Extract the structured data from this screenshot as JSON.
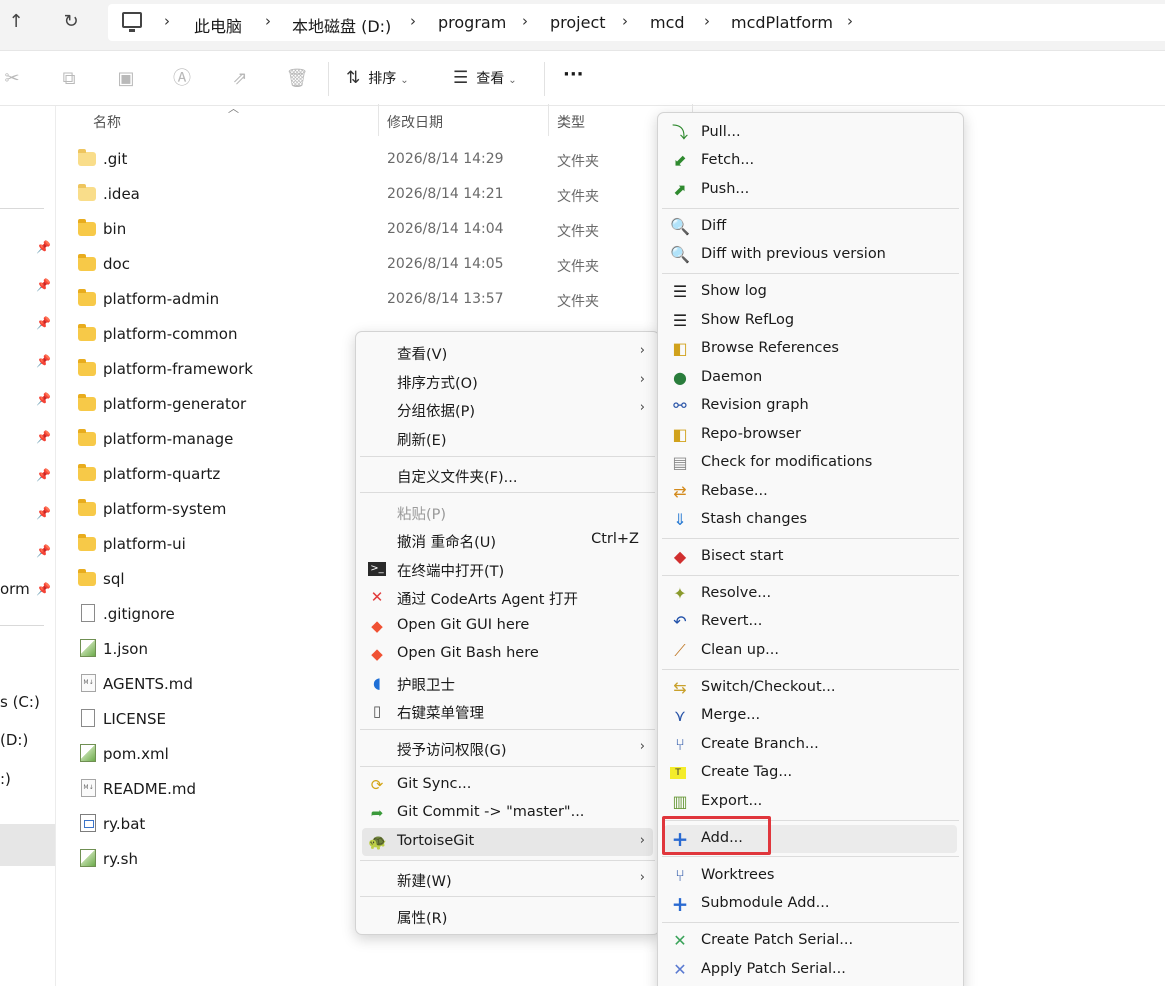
{
  "breadcrumb": [
    "此电脑",
    "本地磁盘 (D:)",
    "program",
    "project",
    "mcd",
    "mcdPlatform"
  ],
  "toolbar": {
    "sort_label": "排序",
    "view_label": "查看",
    "more_label": "···"
  },
  "columns": {
    "name": "名称",
    "date": "修改日期",
    "type": "类型"
  },
  "files": [
    {
      "name": ".git",
      "date": "2026/8/14 14:29",
      "type": "文件夹",
      "icon": "folder-light-icon"
    },
    {
      "name": ".idea",
      "date": "2026/8/14 14:21",
      "type": "文件夹",
      "icon": "folder-light-icon"
    },
    {
      "name": "bin",
      "date": "2026/8/14 14:04",
      "type": "文件夹",
      "icon": "folder-icon"
    },
    {
      "name": "doc",
      "date": "2026/8/14 14:05",
      "type": "文件夹",
      "icon": "folder-icon"
    },
    {
      "name": "platform-admin",
      "date": "2026/8/14 13:57",
      "type": "文件夹",
      "icon": "folder-icon"
    },
    {
      "name": "platform-common",
      "date": "",
      "type": "",
      "icon": "folder-icon"
    },
    {
      "name": "platform-framework",
      "date": "",
      "type": "",
      "icon": "folder-icon"
    },
    {
      "name": "platform-generator",
      "date": "",
      "type": "",
      "icon": "folder-icon"
    },
    {
      "name": "platform-manage",
      "date": "",
      "type": "",
      "icon": "folder-icon"
    },
    {
      "name": "platform-quartz",
      "date": "",
      "type": "",
      "icon": "folder-icon"
    },
    {
      "name": "platform-system",
      "date": "",
      "type": "",
      "icon": "folder-icon"
    },
    {
      "name": "platform-ui",
      "date": "",
      "type": "",
      "icon": "folder-icon"
    },
    {
      "name": "sql",
      "date": "",
      "type": "",
      "icon": "folder-icon"
    },
    {
      "name": ".gitignore",
      "date": "",
      "type": "",
      "icon": "file-icon"
    },
    {
      "name": "1.json",
      "date": "",
      "type": "",
      "icon": "image-file-icon"
    },
    {
      "name": "AGENTS.md",
      "date": "",
      "type": "",
      "icon": "markdown-file-icon"
    },
    {
      "name": "LICENSE",
      "date": "",
      "type": "",
      "icon": "file-icon"
    },
    {
      "name": "pom.xml",
      "date": "",
      "type": "",
      "icon": "image-file-icon"
    },
    {
      "name": "README.md",
      "date": "",
      "type": "",
      "icon": "markdown-file-icon"
    },
    {
      "name": "ry.bat",
      "date": "",
      "type": "",
      "icon": "batch-file-icon"
    },
    {
      "name": "ry.sh",
      "date": "",
      "type": "",
      "icon": "image-file-icon"
    }
  ],
  "nav": {
    "item_orm": "orm",
    "item_c": "s (C:)",
    "item_d": "(D:)",
    "item_e": ":)"
  },
  "context_menu": {
    "view": "查看(V)",
    "sort": "排序方式(O)",
    "group": "分组依据(P)",
    "refresh": "刷新(E)",
    "customize": "自定义文件夹(F)...",
    "paste": "粘贴(P)",
    "undo": "撤消 重命名(U)",
    "undo_shortcut": "Ctrl+Z",
    "terminal": "在终端中打开(T)",
    "codearts": "通过 CodeArts Agent 打开",
    "git_gui": "Open Git GUI here",
    "git_bash": "Open Git Bash here",
    "eye": "护眼卫士",
    "rmenu": "右键菜单管理",
    "access": "授予访问权限(G)",
    "git_sync": "Git Sync...",
    "git_commit": "Git Commit -> \"master\"...",
    "tortoise": "TortoiseGit",
    "new": "新建(W)",
    "props": "属性(R)"
  },
  "submenu": {
    "pull": "Pull...",
    "fetch": "Fetch...",
    "push": "Push...",
    "diff": "Diff",
    "diff_prev": "Diff with previous version",
    "show_log": "Show log",
    "show_reflog": "Show RefLog",
    "browse_refs": "Browse References",
    "daemon": "Daemon",
    "rev_graph": "Revision graph",
    "repo_browser": "Repo-browser",
    "check_mod": "Check for modifications",
    "rebase": "Rebase...",
    "stash": "Stash changes",
    "bisect": "Bisect start",
    "resolve": "Resolve...",
    "revert": "Revert...",
    "cleanup": "Clean up...",
    "switch": "Switch/Checkout...",
    "merge": "Merge...",
    "branch": "Create Branch...",
    "tag": "Create Tag...",
    "export": "Export...",
    "add": "Add...",
    "worktrees": "Worktrees",
    "submodule": "Submodule Add...",
    "patch_serial": "Create Patch Serial...",
    "apply_patch": "Apply Patch Serial..."
  }
}
